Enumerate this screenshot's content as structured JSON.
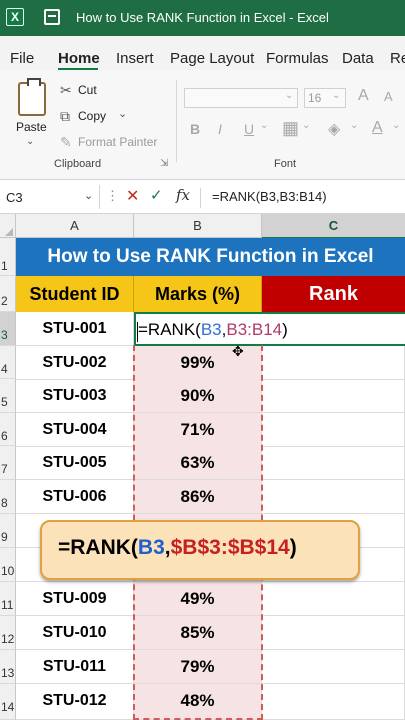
{
  "window": {
    "title": "How to Use RANK Function in Excel  -  Excel",
    "logo": "X"
  },
  "ribbon": {
    "tabs": [
      "File",
      "Home",
      "Insert",
      "Page Layout",
      "Formulas",
      "Data",
      "Re"
    ],
    "active_tab": "Home",
    "clipboard": {
      "paste": "Paste",
      "cut": "Cut",
      "copy": "Copy",
      "format_painter": "Format Painter",
      "group_label": "Clipboard"
    },
    "font": {
      "size": "16",
      "bold": "B",
      "italic": "I",
      "underline": "U",
      "grow": "A",
      "shrink": "A",
      "font_color": "A",
      "group_label": "Font"
    }
  },
  "formula_bar": {
    "name_box": "C3",
    "formula": "=RANK(B3,B3:B14)"
  },
  "columns": [
    "A",
    "B",
    "C"
  ],
  "selected_column": "C",
  "row_numbers": [
    "1",
    "2",
    "3",
    "4",
    "5",
    "6",
    "7",
    "8",
    "9",
    "10",
    "11",
    "12",
    "13",
    "14"
  ],
  "selected_row": "3",
  "sheet": {
    "title": "How to Use RANK Function in Excel",
    "headers": {
      "a": "Student ID",
      "b": "Marks (%)",
      "c": "Rank"
    },
    "editing_formula": {
      "prefix": "=RANK(",
      "ref1": "B3",
      "comma": ",",
      "ref2": "B3:B14",
      "suffix": ")"
    },
    "editing_id": "STU-001",
    "rows": [
      {
        "id": "STU-002",
        "marks": "99%"
      },
      {
        "id": "STU-003",
        "marks": "90%"
      },
      {
        "id": "STU-004",
        "marks": "71%"
      },
      {
        "id": "STU-005",
        "marks": "63%"
      },
      {
        "id": "STU-006",
        "marks": "86%"
      },
      {
        "id": "STU-009",
        "marks": "49%"
      },
      {
        "id": "STU-010",
        "marks": "85%"
      },
      {
        "id": "STU-011",
        "marks": "79%"
      },
      {
        "id": "STU-012",
        "marks": "48%"
      }
    ]
  },
  "callout": {
    "prefix": "=RANK(",
    "ref1": "B3",
    "comma": ",",
    "ref2": "$B$3:$B$14",
    "suffix": ")"
  },
  "colors": {
    "title_bar": "#1f6e43",
    "title_cell": "#1e73be",
    "header_yellow": "#f5c518",
    "header_red": "#c00000",
    "marks_fill": "#f6e3e3",
    "callout_fill": "#fbe2b8",
    "ref_blue": "#2f6fd6",
    "ref_red": "#c62020"
  }
}
